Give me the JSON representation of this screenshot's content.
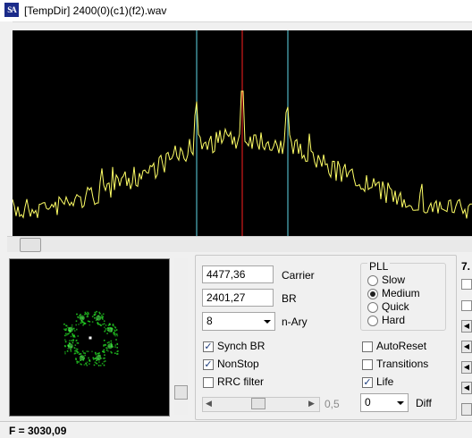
{
  "window": {
    "icon_text": "SA",
    "title": "[TempDir] 2400(0)(c1)(f2).wav"
  },
  "spectrum": {
    "trace_color": "#ffff66",
    "center_marker_color": "#ff2020",
    "br_marker_color": "#60d8e8"
  },
  "constellation": {
    "points_color": "#22cc22"
  },
  "controls": {
    "carrier_value": "4477,36",
    "carrier_label": "Carrier",
    "br_value": "2401,27",
    "br_label": "BR",
    "nary_value": "8",
    "nary_label": "n-Ary",
    "pll": {
      "title": "PLL",
      "options": [
        "Slow",
        "Medium",
        "Quick",
        "Hard"
      ],
      "selected": "Medium"
    },
    "checkboxes": {
      "synch_br": {
        "label": "Synch BR",
        "checked": true
      },
      "nonstop": {
        "label": "NonStop",
        "checked": true
      },
      "rrc_filter": {
        "label": "RRC filter",
        "checked": false
      },
      "autoreset": {
        "label": "AutoReset",
        "checked": false
      },
      "transitions": {
        "label": "Transitions",
        "checked": false
      },
      "life": {
        "label": "Life",
        "checked": true
      }
    },
    "rrc_slider_value": "0,5",
    "diff_value": "0",
    "diff_label": "Diff"
  },
  "right_panel": {
    "partial_label": "7."
  },
  "status": {
    "text": "F = 3030,09"
  }
}
